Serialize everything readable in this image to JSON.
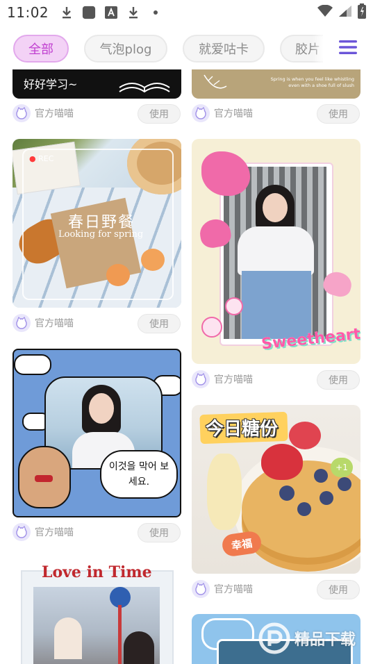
{
  "status_bar": {
    "time": "11:02"
  },
  "tabs": [
    {
      "label": "全部",
      "active": true
    },
    {
      "label": "气泡plog",
      "active": false
    },
    {
      "label": "就爱咕卡",
      "active": false
    },
    {
      "label": "胶片",
      "active": false
    }
  ],
  "menu_icon": "hamburger-menu-icon",
  "cards": [
    {
      "author": "官方喵喵",
      "use_label": "使用",
      "overlay": "好好学习~"
    },
    {
      "author": "官方喵喵",
      "use_label": "使用",
      "overlay": "Spring is when you feel like whistling even with a shoe full of slush"
    },
    {
      "author": "官方喵喵",
      "use_label": "使用",
      "overlay_rec": "REC",
      "overlay_title": "春日野餐",
      "overlay_sub": "Looking for spring"
    },
    {
      "author": "官方喵喵",
      "use_label": "使用",
      "overlay": "Sweetheart"
    },
    {
      "author": "官方喵喵",
      "use_label": "使用",
      "overlay": "이것을 막어 보세요."
    },
    {
      "author": "官方喵喵",
      "use_label": "使用",
      "overlay_title": "今日糖份",
      "overlay_badge": "幸福",
      "overlay_plus": "+1"
    },
    {
      "overlay": "Love in Time"
    }
  ],
  "watermark": "精品下载",
  "colors": {
    "active_tab_bg": "#f3d2f6",
    "active_tab_text": "#c03fd0",
    "menu_icon": "#6b55d8",
    "avatar_bg": "#e9e6fb"
  }
}
